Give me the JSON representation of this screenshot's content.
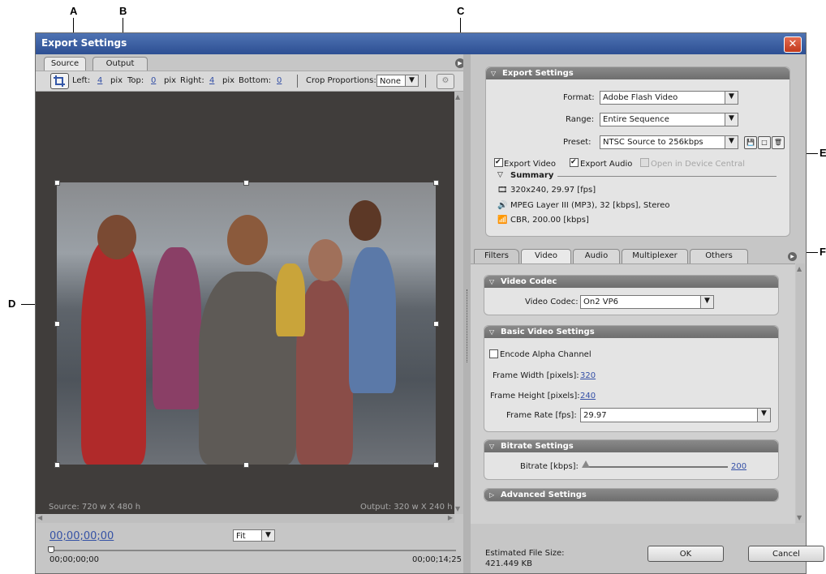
{
  "callouts": {
    "a": "A",
    "b": "B",
    "c": "C",
    "d": "D",
    "e": "E",
    "f": "F"
  },
  "window": {
    "title": "Export Settings",
    "close_glyph": "✕"
  },
  "left": {
    "tabs": [
      {
        "label": "Source"
      },
      {
        "label": "Output"
      }
    ],
    "crop": {
      "left_label": "Left:",
      "left_value": "4",
      "left_unit": "pix",
      "top_label": "Top:",
      "top_value": "0",
      "top_unit": "pix",
      "right_label": "Right:",
      "right_value": "4",
      "right_unit": "pix",
      "bottom_label": "Bottom:",
      "bottom_value": "0",
      "proportions_label": "Crop Proportions:",
      "proportions_value": "None"
    },
    "source_info": "Source: 720 w X 480 h",
    "output_info": "Output: 320 w X 240 h",
    "timecode": "00;00;00;00",
    "zoom": "Fit",
    "time_start": "00;00;00;00",
    "time_end": "00;00;14;25"
  },
  "export_settings": {
    "header": "Export Settings",
    "format_label": "Format:",
    "format_value": "Adobe Flash Video",
    "range_label": "Range:",
    "range_value": "Entire Sequence",
    "preset_label": "Preset:",
    "preset_value": "NTSC Source to 256kbps",
    "export_video": "Export Video",
    "export_audio": "Export Audio",
    "open_device": "Open in Device Central",
    "summary_label": "Summary",
    "summary_video": "320x240, 29.97 [fps]",
    "summary_audio": "MPEG Layer III (MP3), 32 [kbps], Stereo",
    "summary_bitrate": "CBR, 200.00 [kbps]"
  },
  "tabs2": [
    {
      "label": "Filters"
    },
    {
      "label": "Video"
    },
    {
      "label": "Audio"
    },
    {
      "label": "Multiplexer"
    },
    {
      "label": "Others"
    }
  ],
  "video_codec": {
    "header": "Video Codec",
    "label": "Video Codec:",
    "value": "On2 VP6"
  },
  "basic": {
    "header": "Basic Video Settings",
    "alpha": "Encode Alpha Channel",
    "width_label": "Frame Width [pixels]:",
    "width_value": "320",
    "height_label": "Frame Height [pixels]:",
    "height_value": "240",
    "rate_label": "Frame Rate [fps]:",
    "rate_value": "29.97"
  },
  "bitrate": {
    "header": "Bitrate Settings",
    "label": "Bitrate [kbps]:",
    "value": "200",
    "slider_fraction": 0.0
  },
  "advanced": {
    "header": "Advanced Settings"
  },
  "footer": {
    "size_label": "Estimated File Size:",
    "size_value": "421.449 KB",
    "ok": "OK",
    "cancel": "Cancel"
  }
}
